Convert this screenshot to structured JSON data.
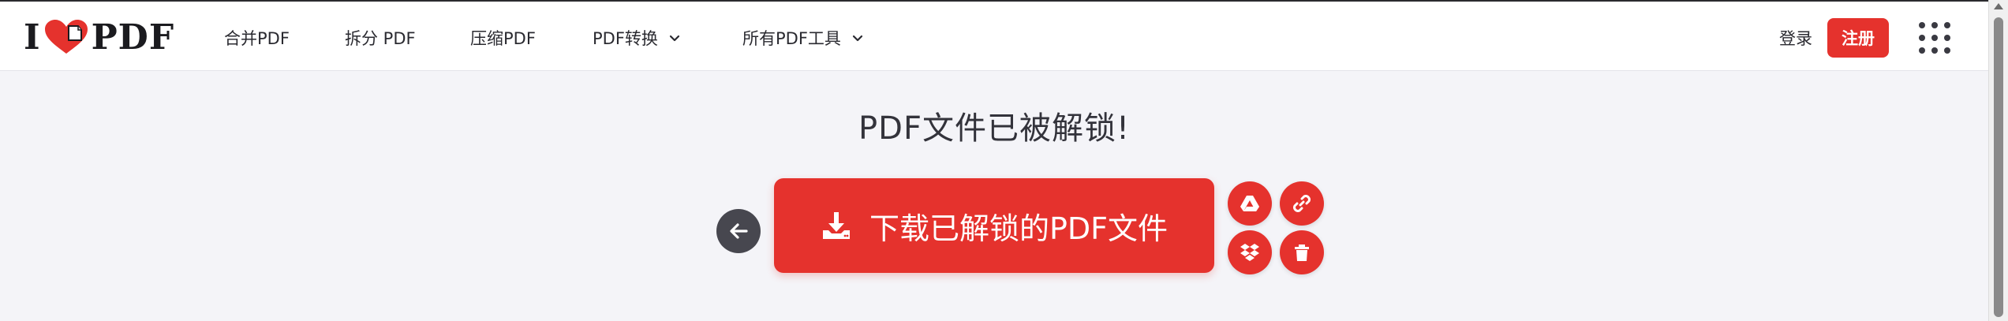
{
  "header": {
    "logo_left": "I",
    "logo_right": "PDF",
    "nav": [
      {
        "label": "合并PDF"
      },
      {
        "label": "拆分 PDF"
      },
      {
        "label": "压缩PDF"
      },
      {
        "label": "PDF转换",
        "has_dropdown": true
      },
      {
        "label": "所有PDF工具",
        "has_dropdown": true
      }
    ],
    "login_label": "登录",
    "register_label": "注册"
  },
  "main": {
    "title": "PDF文件已被解锁!",
    "download_label": "下载已解锁的PDF文件",
    "side_actions": [
      "google-drive-icon",
      "link-icon",
      "dropbox-icon",
      "trash-icon"
    ]
  },
  "colors": {
    "brand_red": "#e5322d",
    "background": "#f4f4f8",
    "dark_button": "#47474f"
  }
}
